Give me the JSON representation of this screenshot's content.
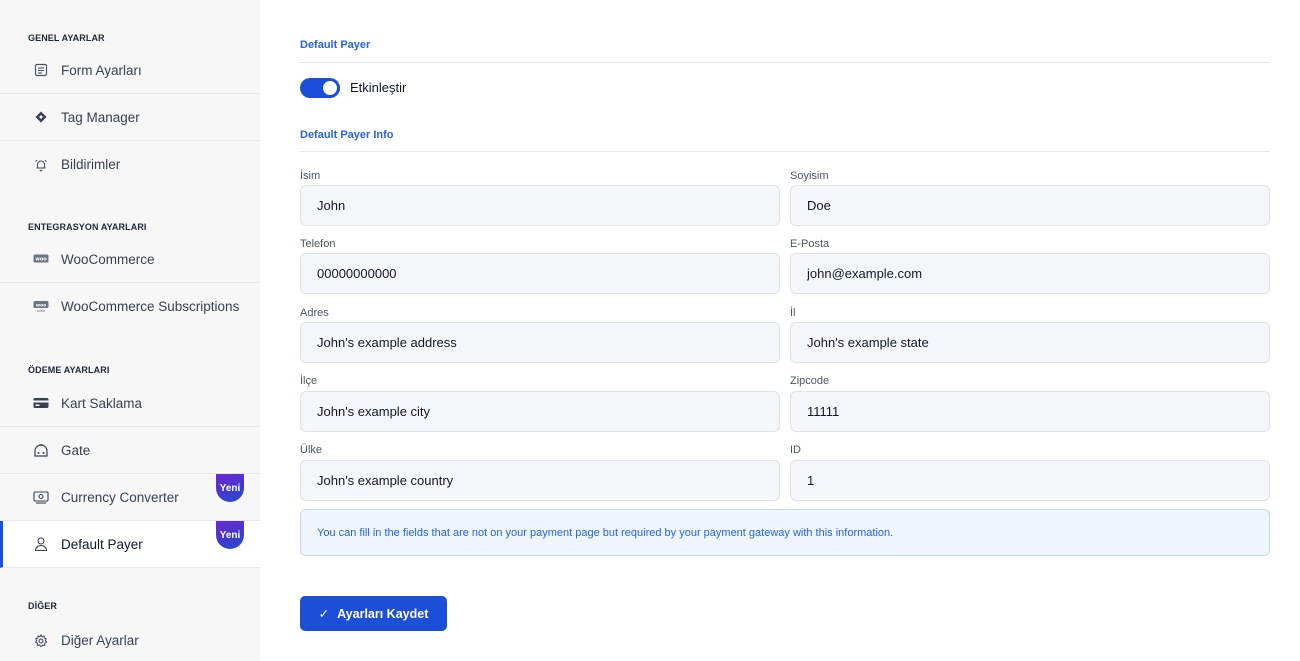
{
  "sidebar": {
    "sections": [
      {
        "title": "GENEL AYARLAR",
        "items": [
          {
            "label": "Form Ayarları",
            "icon": "form-icon"
          },
          {
            "label": "Tag Manager",
            "icon": "diamond-icon"
          },
          {
            "label": "Bildirimler",
            "icon": "bell-icon"
          }
        ]
      },
      {
        "title": "ENTEGRASYON AYARLARI",
        "items": [
          {
            "label": "WooCommerce",
            "icon": "woo-icon"
          },
          {
            "label": "WooCommerce Subscriptions",
            "icon": "woo-subs-icon"
          }
        ]
      },
      {
        "title": "ÖDEME AYARLARI",
        "items": [
          {
            "label": "Kart Saklama",
            "icon": "card-icon"
          },
          {
            "label": "Gate",
            "icon": "gate-icon"
          },
          {
            "label": "Currency Converter",
            "icon": "money-icon",
            "badge": "Yeni"
          },
          {
            "label": "Default Payer",
            "icon": "user-icon",
            "badge": "Yeni",
            "active": true
          }
        ]
      },
      {
        "title": "DİĞER",
        "items": [
          {
            "label": "Diğer Ayarlar",
            "icon": "gear-icon"
          }
        ]
      }
    ]
  },
  "main": {
    "section_title": "Default Payer",
    "toggle": {
      "label": "Etkinleştir",
      "enabled": true
    },
    "info_title": "Default Payer Info",
    "fields": {
      "first_name": {
        "label": "İsim",
        "value": "John"
      },
      "last_name": {
        "label": "Soyisim",
        "value": "Doe"
      },
      "phone": {
        "label": "Telefon",
        "value": "00000000000"
      },
      "email": {
        "label": "E-Posta",
        "value": "john@example.com"
      },
      "address": {
        "label": "Adres",
        "value": "John's example address"
      },
      "state": {
        "label": "İl",
        "value": "John's example state"
      },
      "city": {
        "label": "İlçe",
        "value": "John's example city"
      },
      "zipcode": {
        "label": "Zipcode",
        "value": "11111"
      },
      "country": {
        "label": "Ülke",
        "value": "John's example country"
      },
      "id": {
        "label": "ID",
        "value": "1"
      }
    },
    "info_text": "You can fill in the fields that are not on your payment page but required by your payment gateway with this information.",
    "save_button": "Ayarları Kaydet"
  },
  "colors": {
    "accent": "#1d4ed8",
    "heading": "#2563eb",
    "badge_from": "#6d28d9",
    "badge_to": "#1d4ed8"
  }
}
